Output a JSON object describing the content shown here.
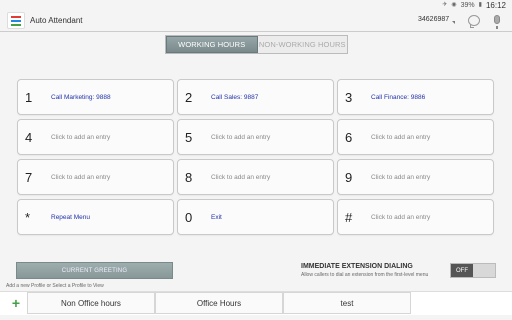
{
  "status": {
    "battery": "39%",
    "time": "16:12"
  },
  "header": {
    "title": "Auto Attendant",
    "account": "34626987"
  },
  "hours_toggle": {
    "working": "WORKING HOURS",
    "non_working": "NON-WORKING HOURS"
  },
  "keys": [
    {
      "num": "1",
      "label": "Call Marketing: 9888"
    },
    {
      "num": "2",
      "label": "Call Sales: 9887"
    },
    {
      "num": "3",
      "label": "Call Finance: 9886"
    },
    {
      "num": "4",
      "label": "Click to add an entry"
    },
    {
      "num": "5",
      "label": "Click to add an entry"
    },
    {
      "num": "6",
      "label": "Click to add an entry"
    },
    {
      "num": "7",
      "label": "Click to add an entry"
    },
    {
      "num": "8",
      "label": "Click to add an entry"
    },
    {
      "num": "9",
      "label": "Click to add an entry"
    },
    {
      "num": "*",
      "label": "Repeat Menu"
    },
    {
      "num": "0",
      "label": "Exit"
    },
    {
      "num": "#",
      "label": "Click to add an entry"
    }
  ],
  "greeting": {
    "button": "CURRENT GREETING"
  },
  "immediate": {
    "title": "IMMEDIATE EXTENSION DIALING",
    "description": "Allow callers to dial an extension from the first-level menu",
    "state": "OFF"
  },
  "profiles": {
    "hint": "Add a new Profile or Select a Profile to View",
    "add": "+",
    "tabs": [
      "Non Office hours",
      "Office Hours",
      "test"
    ]
  },
  "colors": {
    "entry_set": "#2233aa",
    "entry_empty": "#888888",
    "active_tab": "#8a9a9c"
  }
}
